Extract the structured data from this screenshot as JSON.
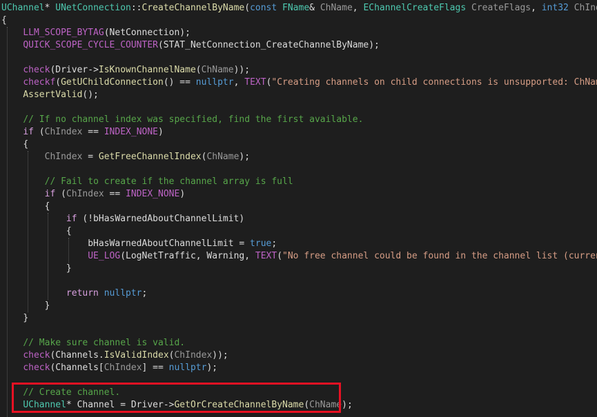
{
  "colors": {
    "background": "#1e1e1e",
    "plain": "#dcdcdc",
    "keyword": "#569cd6",
    "control": "#d8a0df",
    "type": "#4ec9b0",
    "function": "#dcdcaa",
    "macro": "#bd63c5",
    "param": "#9a9a9a",
    "string": "#d69d85",
    "comment": "#57a64a",
    "highlight": "#e81123"
  },
  "lines": [
    {
      "segs": [
        {
          "t": "UChannel",
          "c": "type"
        },
        {
          "t": "* ",
          "c": "plain"
        },
        {
          "t": "UNetConnection",
          "c": "type"
        },
        {
          "t": "::",
          "c": "plain"
        },
        {
          "t": "CreateChannelByName",
          "c": "function"
        },
        {
          "t": "(",
          "c": "plain"
        },
        {
          "t": "const",
          "c": "keyword"
        },
        {
          "t": " ",
          "c": "plain"
        },
        {
          "t": "FName",
          "c": "type"
        },
        {
          "t": "& ",
          "c": "plain"
        },
        {
          "t": "ChName",
          "c": "param"
        },
        {
          "t": ", ",
          "c": "plain"
        },
        {
          "t": "EChannelCreateFlags",
          "c": "type"
        },
        {
          "t": " ",
          "c": "plain"
        },
        {
          "t": "CreateFlags",
          "c": "param"
        },
        {
          "t": ", ",
          "c": "plain"
        },
        {
          "t": "int32",
          "c": "keyword"
        },
        {
          "t": " ",
          "c": "plain"
        },
        {
          "t": "ChIndex",
          "c": "param"
        },
        {
          "t": ")",
          "c": "plain"
        }
      ]
    },
    {
      "segs": [
        {
          "t": "{",
          "c": "plain"
        }
      ]
    },
    {
      "segs": [
        {
          "t": "    ",
          "c": "plain"
        },
        {
          "t": "LLM_SCOPE_BYTAG",
          "c": "macro"
        },
        {
          "t": "(NetConnection);",
          "c": "plain"
        }
      ]
    },
    {
      "segs": [
        {
          "t": "    ",
          "c": "plain"
        },
        {
          "t": "QUICK_SCOPE_CYCLE_COUNTER",
          "c": "macro"
        },
        {
          "t": "(STAT_NetConnection_CreateChannelByName);",
          "c": "plain"
        }
      ]
    },
    {
      "segs": []
    },
    {
      "segs": [
        {
          "t": "    ",
          "c": "plain"
        },
        {
          "t": "check",
          "c": "macro"
        },
        {
          "t": "(Driver->",
          "c": "plain"
        },
        {
          "t": "IsKnownChannelName",
          "c": "function"
        },
        {
          "t": "(",
          "c": "plain"
        },
        {
          "t": "ChName",
          "c": "param"
        },
        {
          "t": "));",
          "c": "plain"
        }
      ]
    },
    {
      "segs": [
        {
          "t": "    ",
          "c": "plain"
        },
        {
          "t": "checkf",
          "c": "macro"
        },
        {
          "t": "(",
          "c": "plain"
        },
        {
          "t": "GetUChildConnection",
          "c": "function"
        },
        {
          "t": "() == ",
          "c": "plain"
        },
        {
          "t": "nullptr",
          "c": "keyword"
        },
        {
          "t": ", ",
          "c": "plain"
        },
        {
          "t": "TEXT",
          "c": "macro"
        },
        {
          "t": "(",
          "c": "plain"
        },
        {
          "t": "\"Creating channels on child connections is unsupported: ChName:",
          "c": "string"
        }
      ]
    },
    {
      "segs": [
        {
          "t": "    ",
          "c": "plain"
        },
        {
          "t": "AssertValid",
          "c": "function"
        },
        {
          "t": "();",
          "c": "plain"
        }
      ]
    },
    {
      "segs": []
    },
    {
      "segs": [
        {
          "t": "    ",
          "c": "plain"
        },
        {
          "t": "// If no channel index was specified, find the first available.",
          "c": "comment"
        }
      ]
    },
    {
      "segs": [
        {
          "t": "    ",
          "c": "plain"
        },
        {
          "t": "if",
          "c": "control"
        },
        {
          "t": " (",
          "c": "plain"
        },
        {
          "t": "ChIndex",
          "c": "param"
        },
        {
          "t": " == ",
          "c": "plain"
        },
        {
          "t": "INDEX_NONE",
          "c": "macro"
        },
        {
          "t": ")",
          "c": "plain"
        }
      ]
    },
    {
      "segs": [
        {
          "t": "    ",
          "c": "plain"
        },
        {
          "t": "{",
          "c": "plain"
        }
      ]
    },
    {
      "segs": [
        {
          "t": "        ",
          "c": "plain"
        },
        {
          "t": "ChIndex",
          "c": "param"
        },
        {
          "t": " = ",
          "c": "plain"
        },
        {
          "t": "GetFreeChannelIndex",
          "c": "function"
        },
        {
          "t": "(",
          "c": "plain"
        },
        {
          "t": "ChName",
          "c": "param"
        },
        {
          "t": ");",
          "c": "plain"
        }
      ]
    },
    {
      "segs": []
    },
    {
      "segs": [
        {
          "t": "        ",
          "c": "plain"
        },
        {
          "t": "// Fail to create if the channel array is full",
          "c": "comment"
        }
      ]
    },
    {
      "segs": [
        {
          "t": "        ",
          "c": "plain"
        },
        {
          "t": "if",
          "c": "control"
        },
        {
          "t": " (",
          "c": "plain"
        },
        {
          "t": "ChIndex",
          "c": "param"
        },
        {
          "t": " == ",
          "c": "plain"
        },
        {
          "t": "INDEX_NONE",
          "c": "macro"
        },
        {
          "t": ")",
          "c": "plain"
        }
      ]
    },
    {
      "segs": [
        {
          "t": "        ",
          "c": "plain"
        },
        {
          "t": "{",
          "c": "plain"
        }
      ]
    },
    {
      "segs": [
        {
          "t": "            ",
          "c": "plain"
        },
        {
          "t": "if",
          "c": "control"
        },
        {
          "t": " (!bHasWarnedAboutChannelLimit)",
          "c": "plain"
        }
      ]
    },
    {
      "segs": [
        {
          "t": "            ",
          "c": "plain"
        },
        {
          "t": "{",
          "c": "plain"
        }
      ]
    },
    {
      "segs": [
        {
          "t": "                ",
          "c": "plain"
        },
        {
          "t": "bHasWarnedAboutChannelLimit = ",
          "c": "plain"
        },
        {
          "t": "true",
          "c": "keyword"
        },
        {
          "t": ";",
          "c": "plain"
        }
      ]
    },
    {
      "segs": [
        {
          "t": "                ",
          "c": "plain"
        },
        {
          "t": "UE_LOG",
          "c": "macro"
        },
        {
          "t": "(LogNetTraffic, Warning, ",
          "c": "plain"
        },
        {
          "t": "TEXT",
          "c": "macro"
        },
        {
          "t": "(",
          "c": "plain"
        },
        {
          "t": "\"No free channel could be found in the channel list (current l",
          "c": "string"
        }
      ]
    },
    {
      "segs": [
        {
          "t": "            ",
          "c": "plain"
        },
        {
          "t": "}",
          "c": "plain"
        }
      ]
    },
    {
      "segs": []
    },
    {
      "segs": [
        {
          "t": "            ",
          "c": "plain"
        },
        {
          "t": "return",
          "c": "control"
        },
        {
          "t": " ",
          "c": "plain"
        },
        {
          "t": "nullptr",
          "c": "keyword"
        },
        {
          "t": ";",
          "c": "plain"
        }
      ]
    },
    {
      "segs": [
        {
          "t": "        ",
          "c": "plain"
        },
        {
          "t": "}",
          "c": "plain"
        }
      ]
    },
    {
      "segs": [
        {
          "t": "    ",
          "c": "plain"
        },
        {
          "t": "}",
          "c": "plain"
        }
      ]
    },
    {
      "segs": []
    },
    {
      "segs": [
        {
          "t": "    ",
          "c": "plain"
        },
        {
          "t": "// Make sure channel is valid.",
          "c": "comment"
        }
      ]
    },
    {
      "segs": [
        {
          "t": "    ",
          "c": "plain"
        },
        {
          "t": "check",
          "c": "macro"
        },
        {
          "t": "(Channels.",
          "c": "plain"
        },
        {
          "t": "IsValidIndex",
          "c": "function"
        },
        {
          "t": "(",
          "c": "plain"
        },
        {
          "t": "ChIndex",
          "c": "param"
        },
        {
          "t": "));",
          "c": "plain"
        }
      ]
    },
    {
      "segs": [
        {
          "t": "    ",
          "c": "plain"
        },
        {
          "t": "check",
          "c": "macro"
        },
        {
          "t": "(Channels[",
          "c": "plain"
        },
        {
          "t": "ChIndex",
          "c": "param"
        },
        {
          "t": "] == ",
          "c": "plain"
        },
        {
          "t": "nullptr",
          "c": "keyword"
        },
        {
          "t": ");",
          "c": "plain"
        }
      ]
    },
    {
      "segs": []
    },
    {
      "segs": [
        {
          "t": "    ",
          "c": "plain"
        },
        {
          "t": "// Create channel.",
          "c": "comment"
        }
      ]
    },
    {
      "segs": [
        {
          "t": "    ",
          "c": "plain"
        },
        {
          "t": "UChannel",
          "c": "type"
        },
        {
          "t": "* Channel = Driver->",
          "c": "plain"
        },
        {
          "t": "GetOrCreateChannelByName",
          "c": "function"
        },
        {
          "t": "(",
          "c": "plain"
        },
        {
          "t": "ChName",
          "c": "param"
        },
        {
          "t": ");",
          "c": "plain"
        }
      ]
    }
  ]
}
